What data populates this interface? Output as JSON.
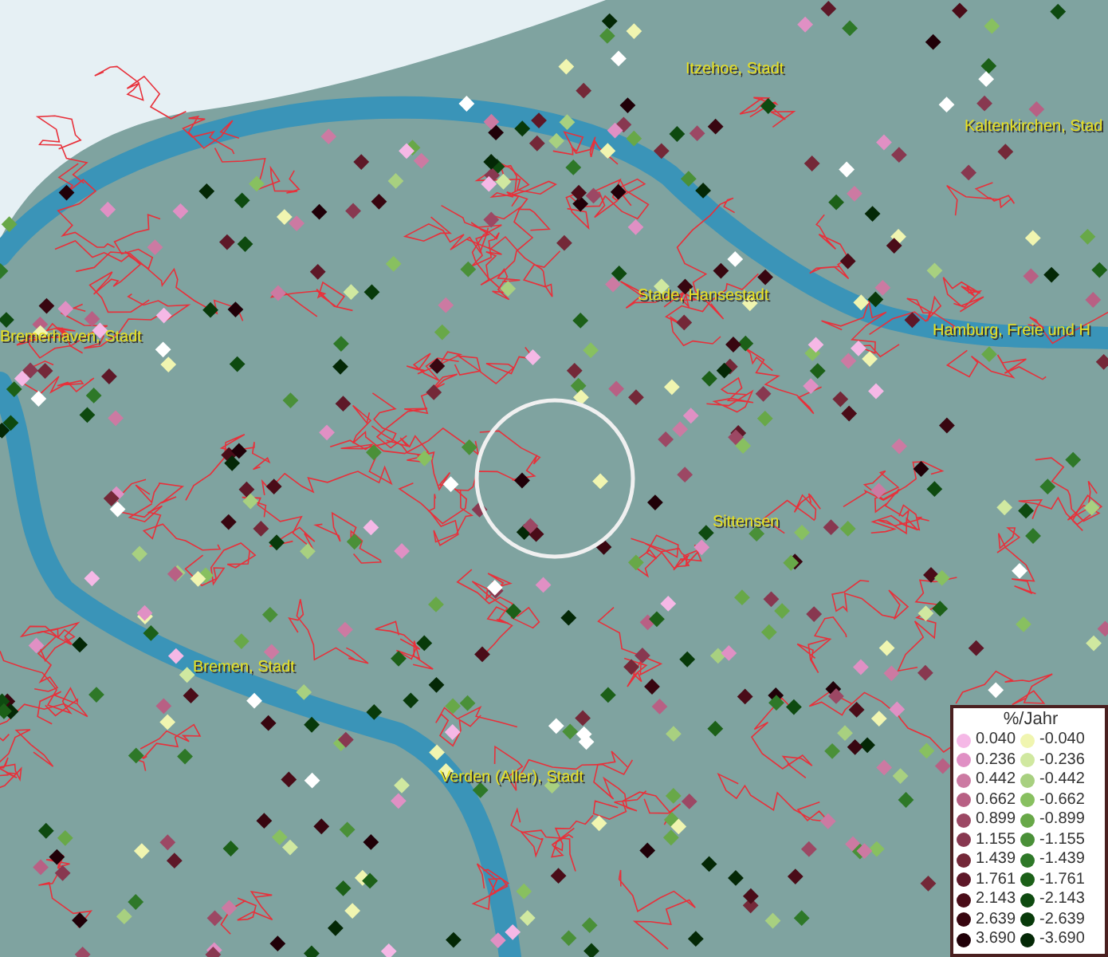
{
  "map": {
    "place_labels": [
      "Itzehoe, Stadt",
      "Kaltenkirchen, Stad",
      "Stade, Hansestadt",
      "Bremerhaven, Stadt",
      "Hamburg, Freie und H",
      "Sittensen",
      "Bremen, Stadt",
      "Verden (Aller), Stadt"
    ]
  },
  "legend": {
    "title": "%/Jahr",
    "left_column": [
      {
        "value": "0.040",
        "color": "#f5b8e6"
      },
      {
        "value": "0.236",
        "color": "#e090c4"
      },
      {
        "value": "0.442",
        "color": "#cc7aa2"
      },
      {
        "value": "0.662",
        "color": "#b86084"
      },
      {
        "value": "0.899",
        "color": "#9c4864"
      },
      {
        "value": "1.155",
        "color": "#883850"
      },
      {
        "value": "1.439",
        "color": "#742838"
      },
      {
        "value": "1.761",
        "color": "#5e1828"
      },
      {
        "value": "2.143",
        "color": "#4a0c18"
      },
      {
        "value": "2.639",
        "color": "#380610"
      },
      {
        "value": "3.690",
        "color": "#200008"
      }
    ],
    "right_column": [
      {
        "value": "-0.040",
        "color": "#f0f5b0"
      },
      {
        "value": "-0.236",
        "color": "#d0e8a0"
      },
      {
        "value": "-0.442",
        "color": "#a8d080"
      },
      {
        "value": "-0.662",
        "color": "#88c060"
      },
      {
        "value": "-0.899",
        "color": "#68a848"
      },
      {
        "value": "-1.155",
        "color": "#4a9038"
      },
      {
        "value": "-1.439",
        "color": "#2e7828"
      },
      {
        "value": "-1.761",
        "color": "#1c6018"
      },
      {
        "value": "-2.143",
        "color": "#0e4a10"
      },
      {
        "value": "-2.639",
        "color": "#083a0a"
      },
      {
        "value": "-3.690",
        "color": "#042806"
      }
    ]
  }
}
